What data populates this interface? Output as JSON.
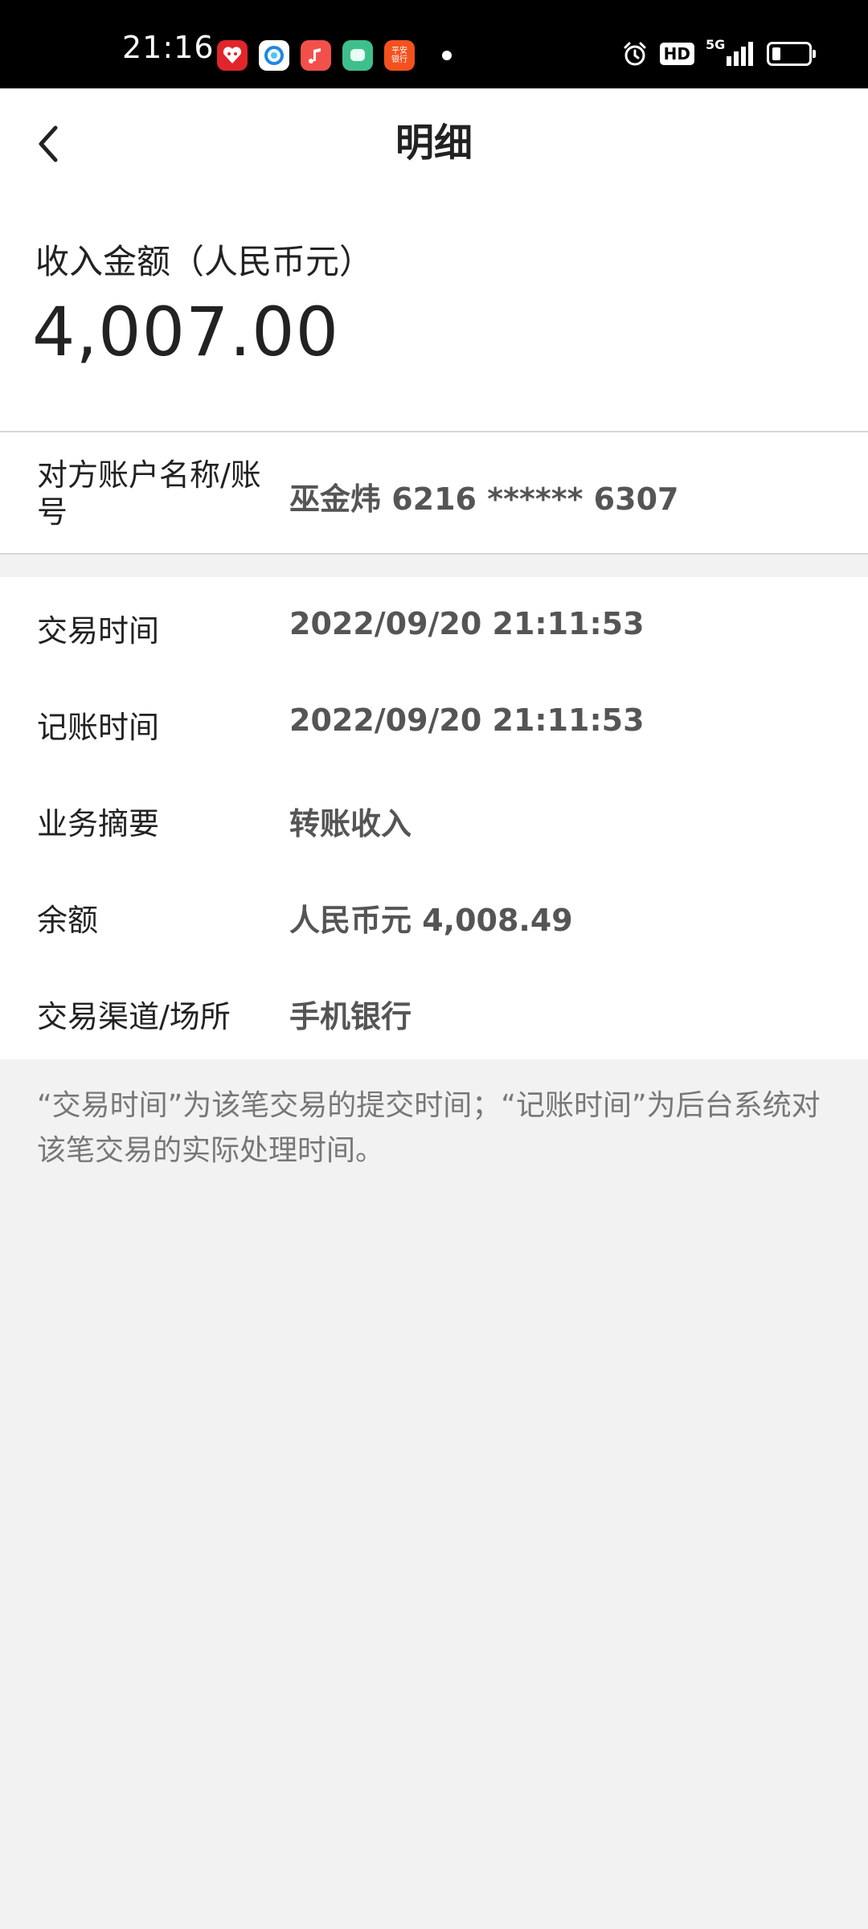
{
  "status_bar": {
    "time": "21:16",
    "app_icons": [
      "pinduoduo-icon",
      "browser-icon",
      "music-icon",
      "messages-icon",
      "pingan-bank-icon"
    ],
    "pingan_label": "平安\n银行",
    "hd": "HD",
    "network": "5G",
    "colors": {
      "background": "#000000"
    }
  },
  "header": {
    "title": "明细",
    "back_icon": "chevron-left-icon"
  },
  "amount": {
    "label": "收入金额（人民币元）",
    "value": "4,007.00"
  },
  "counterparty": {
    "label": "对方账户名称/账号",
    "value": "巫金炜 6216 ****** 6307"
  },
  "details": {
    "rows": [
      {
        "label": "交易时间",
        "value": "2022/09/20  21:11:53"
      },
      {
        "label": "记账时间",
        "value": "2022/09/20  21:11:53"
      },
      {
        "label": "业务摘要",
        "value": "转账收入"
      },
      {
        "label": "余额",
        "value": "人民币元 4,008.49"
      },
      {
        "label": "交易渠道/场所",
        "value": "手机银行"
      }
    ]
  },
  "note": "“交易时间”为该笔交易的提交时间；“记账时间”为后台系统对该笔交易的实际处理时间。",
  "colors": {
    "page_background": "#f2f2f2",
    "card_background": "#ffffff",
    "value_text": "#555555",
    "note_text": "#777777"
  }
}
